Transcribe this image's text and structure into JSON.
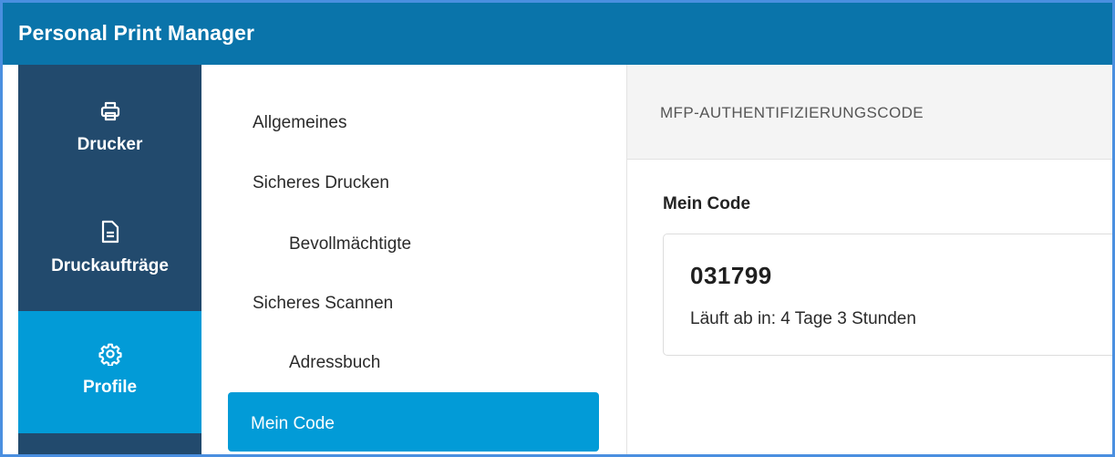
{
  "app": {
    "title": "Personal Print Manager"
  },
  "sidebar": {
    "items": [
      {
        "label": "Drucker",
        "icon": "printer-icon",
        "active": false
      },
      {
        "label": "Druckaufträge",
        "icon": "document-icon",
        "active": false
      },
      {
        "label": "Profile",
        "icon": "gear-icon",
        "active": true
      }
    ],
    "colors": {
      "background": "#224a6d",
      "active": "#029bd7"
    }
  },
  "submenu": {
    "items": [
      {
        "label": "Allgemeines",
        "indent": false,
        "active": false
      },
      {
        "label": "Sicheres Drucken",
        "indent": false,
        "active": false
      },
      {
        "label": "Bevollmächtigte",
        "indent": true,
        "active": false
      },
      {
        "label": "Sicheres Scannen",
        "indent": false,
        "active": false
      },
      {
        "label": "Adressbuch",
        "indent": true,
        "active": false
      },
      {
        "label": "Mein Code",
        "indent": false,
        "active": true
      }
    ]
  },
  "main": {
    "header": "MFP-AUTHENTIFIZIERUNGSCODE",
    "section_title": "Mein Code",
    "code": "031799",
    "expiry": "Läuft ab in: 4 Tage 3 Stunden"
  },
  "colors": {
    "titlebar": "#0a74aa",
    "accent": "#029bd7"
  }
}
